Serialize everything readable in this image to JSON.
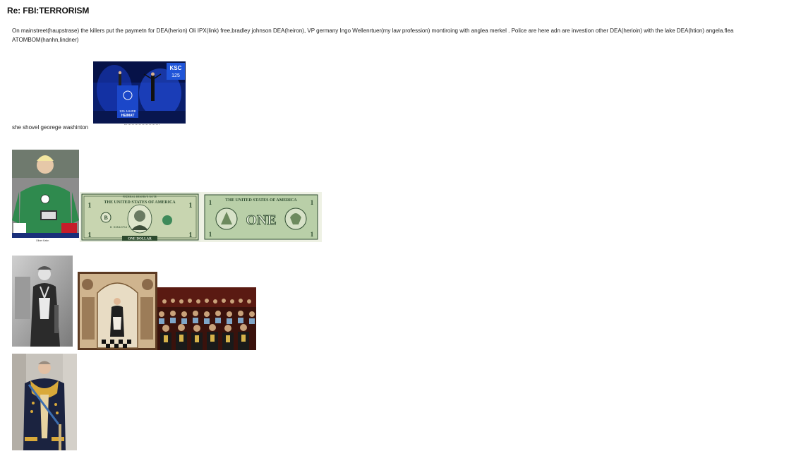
{
  "post": {
    "title": "Re: FBI:TERRORISM",
    "body": "On mainstreet(haupstrase) the killers put the paymetn for DEA(herion) Oli IPX(link) free,bradley johnson DEA(heiron), VP germany Ingo Wellenrtuer(my law profession) montiroing with anglea merkel . Police are here adn are investion other DEA(herioin) with the lake DEA(htion) angela.flea ATOMBOM(hanhn,lindner)",
    "caption": "she shovel georege washinton"
  },
  "images": {
    "stage": {
      "icon": "stage-photo-icon",
      "logo_text": "KSC",
      "logo_num": "125",
      "sign_line1": "125 JAHRE",
      "sign_line2": "HEIMAT"
    },
    "keeper": {
      "icon": "goalkeeper-photo-icon",
      "name_caption": "Oliver Kahn"
    },
    "dollar_front": {
      "icon": "dollar-front-icon",
      "header": "FEDERAL RESERVE NOTE",
      "banner": "THE UNITED STATES OF AMERICA",
      "serial": "B 03542754 F",
      "seal_letter": "B",
      "denomination": "1",
      "footer": "ONE DOLLAR"
    },
    "dollar_back": {
      "icon": "dollar-back-icon",
      "banner": "THE UNITED STATES OF AMERICA",
      "word": "ONE",
      "denomination": "1"
    },
    "mason_portrait": {
      "icon": "mason-portrait-icon"
    },
    "mason_painting": {
      "icon": "mason-painting-icon"
    },
    "lodge_crowd": {
      "icon": "lodge-crowd-icon"
    },
    "king_portrait": {
      "icon": "king-portrait-icon"
    }
  },
  "colors": {
    "stage_bg": "#0a1f6e",
    "stage_light": "#2a5cff",
    "keeper_shirt": "#2f8a4e",
    "note_green": "#c8d5b0",
    "note_ink": "#2c4a2e"
  }
}
